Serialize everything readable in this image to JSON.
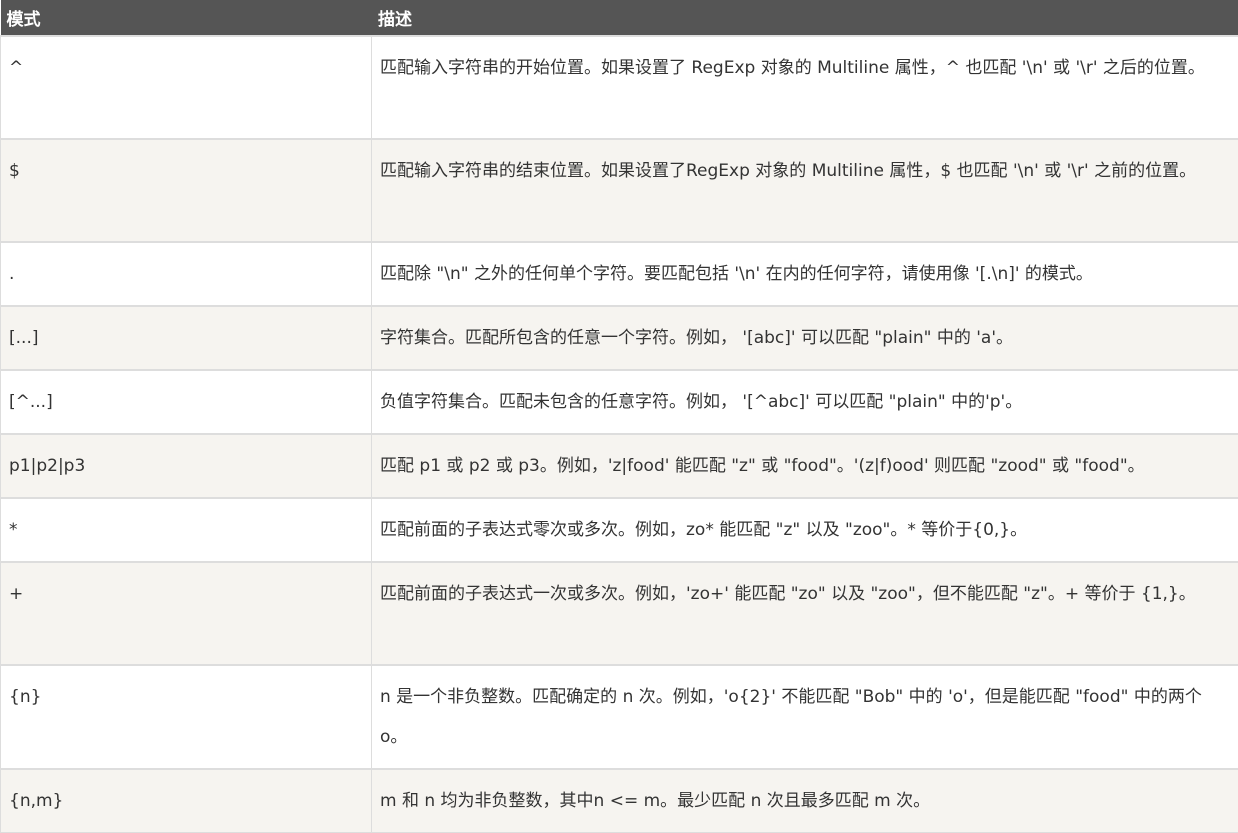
{
  "table": {
    "headers": {
      "pattern": "模式",
      "description": "描述"
    },
    "rows": [
      {
        "pattern": "^",
        "description": "匹配输入字符串的开始位置。如果设置了 RegExp 对象的 Multiline 属性，^ 也匹配 '\\n' 或 '\\r' 之后的位置。"
      },
      {
        "pattern": "$",
        "description": "匹配输入字符串的结束位置。如果设置了RegExp 对象的 Multiline 属性，$ 也匹配 '\\n' 或 '\\r' 之前的位置。"
      },
      {
        "pattern": ".",
        "description": "匹配除 \"\\n\" 之外的任何单个字符。要匹配包括 '\\n' 在内的任何字符，请使用像 '[.\\n]' 的模式。"
      },
      {
        "pattern": "[...]",
        "description": "字符集合。匹配所包含的任意一个字符。例如， '[abc]' 可以匹配 \"plain\" 中的 'a'。"
      },
      {
        "pattern": "[^...]",
        "description": "负值字符集合。匹配未包含的任意字符。例如， '[^abc]' 可以匹配 \"plain\" 中的'p'。"
      },
      {
        "pattern": "p1|p2|p3",
        "description": "匹配 p1 或 p2 或 p3。例如，'z|food' 能匹配 \"z\" 或 \"food\"。'(z|f)ood' 则匹配 \"zood\" 或 \"food\"。"
      },
      {
        "pattern": "*",
        "description": "匹配前面的子表达式零次或多次。例如，zo* 能匹配 \"z\" 以及 \"zoo\"。* 等价于{0,}。"
      },
      {
        "pattern": "+",
        "description": "匹配前面的子表达式一次或多次。例如，'zo+' 能匹配 \"zo\" 以及 \"zoo\"，但不能匹配 \"z\"。+ 等价于 {1,}。"
      },
      {
        "pattern": "{n}",
        "description": "n 是一个非负整数。匹配确定的 n 次。例如，'o{2}' 不能匹配 \"Bob\" 中的 'o'，但是能匹配 \"food\" 中的两个 o。"
      },
      {
        "pattern": "{n,m}",
        "description": "m 和 n 均为非负整数，其中n <= m。最少匹配 n 次且最多匹配 m 次。"
      }
    ]
  }
}
